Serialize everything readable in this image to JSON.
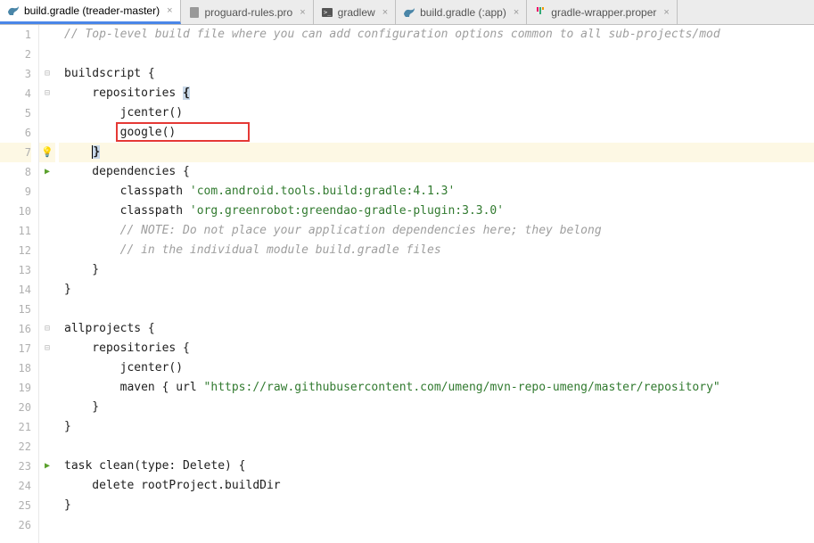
{
  "tabs": [
    {
      "label": "build.gradle (treader-master)",
      "icon": "gradle",
      "active": true
    },
    {
      "label": "proguard-rules.pro",
      "icon": "file",
      "active": false
    },
    {
      "label": "gradlew",
      "icon": "terminal",
      "active": false
    },
    {
      "label": "build.gradle (:app)",
      "icon": "gradle",
      "active": false
    },
    {
      "label": "gradle-wrapper.proper",
      "icon": "props",
      "active": false
    }
  ],
  "code": {
    "lines": [
      {
        "n": 1,
        "spans": [
          {
            "t": "// Top-level build file where you can add configuration options common to all sub-projects/mod",
            "c": "t-comment"
          }
        ]
      },
      {
        "n": 2,
        "spans": []
      },
      {
        "n": 3,
        "spans": [
          {
            "t": "buildscript {",
            "c": "t-keyword"
          }
        ],
        "fold": "start"
      },
      {
        "n": 4,
        "spans": [
          {
            "t": "    repositories ",
            "c": "t-keyword"
          },
          {
            "t": "{",
            "c": "t-keyword hl-brace"
          }
        ],
        "fold": "start"
      },
      {
        "n": 5,
        "spans": [
          {
            "t": "        jcenter()",
            "c": "t-name"
          }
        ]
      },
      {
        "n": 6,
        "spans": [
          {
            "t": "        google()",
            "c": "t-name"
          }
        ],
        "boxed": true
      },
      {
        "n": 7,
        "spans": [
          {
            "t": "    ",
            "c": ""
          },
          {
            "t": "}",
            "c": "t-keyword hl-brace caret"
          }
        ],
        "highlighted": true,
        "marker": "bulb"
      },
      {
        "n": 8,
        "spans": [
          {
            "t": "    dependencies {",
            "c": "t-keyword"
          }
        ],
        "fold": "start",
        "marker": "play"
      },
      {
        "n": 9,
        "spans": [
          {
            "t": "        classpath ",
            "c": "t-name"
          },
          {
            "t": "'com.android.tools.build:gradle:4.1.3'",
            "c": "t-string"
          }
        ]
      },
      {
        "n": 10,
        "spans": [
          {
            "t": "        classpath ",
            "c": "t-name"
          },
          {
            "t": "'org.greenrobot:greendao-gradle-plugin:3.3.0'",
            "c": "t-string"
          }
        ]
      },
      {
        "n": 11,
        "spans": [
          {
            "t": "        // NOTE: Do not place your application dependencies here; they belong",
            "c": "t-comment"
          }
        ]
      },
      {
        "n": 12,
        "spans": [
          {
            "t": "        // in the individual module build.gradle files",
            "c": "t-comment"
          }
        ]
      },
      {
        "n": 13,
        "spans": [
          {
            "t": "    }",
            "c": "t-keyword"
          }
        ]
      },
      {
        "n": 14,
        "spans": [
          {
            "t": "}",
            "c": "t-keyword"
          }
        ]
      },
      {
        "n": 15,
        "spans": []
      },
      {
        "n": 16,
        "spans": [
          {
            "t": "allprojects {",
            "c": "t-keyword"
          }
        ],
        "fold": "start"
      },
      {
        "n": 17,
        "spans": [
          {
            "t": "    repositories {",
            "c": "t-keyword"
          }
        ],
        "fold": "start"
      },
      {
        "n": 18,
        "spans": [
          {
            "t": "        jcenter()",
            "c": "t-name"
          }
        ]
      },
      {
        "n": 19,
        "spans": [
          {
            "t": "        maven { ",
            "c": "t-name"
          },
          {
            "t": "url ",
            "c": "t-type"
          },
          {
            "t": "\"https://raw.githubusercontent.com/umeng/mvn-repo-umeng/master/repository\"",
            "c": "t-url"
          }
        ]
      },
      {
        "n": 20,
        "spans": [
          {
            "t": "    }",
            "c": "t-keyword"
          }
        ]
      },
      {
        "n": 21,
        "spans": [
          {
            "t": "}",
            "c": "t-keyword"
          }
        ]
      },
      {
        "n": 22,
        "spans": []
      },
      {
        "n": 23,
        "spans": [
          {
            "t": "task clean(",
            "c": "t-name"
          },
          {
            "t": "type",
            "c": "t-type"
          },
          {
            "t": ": Delete) {",
            "c": "t-name"
          }
        ],
        "fold": "start",
        "marker": "play"
      },
      {
        "n": 24,
        "spans": [
          {
            "t": "    delete rootProject.buildDir",
            "c": "t-name"
          }
        ]
      },
      {
        "n": 25,
        "spans": [
          {
            "t": "}",
            "c": "t-keyword"
          }
        ]
      },
      {
        "n": 26,
        "spans": []
      }
    ]
  },
  "annotations": {
    "red_box_line": 6,
    "highlighted_line": 7
  }
}
